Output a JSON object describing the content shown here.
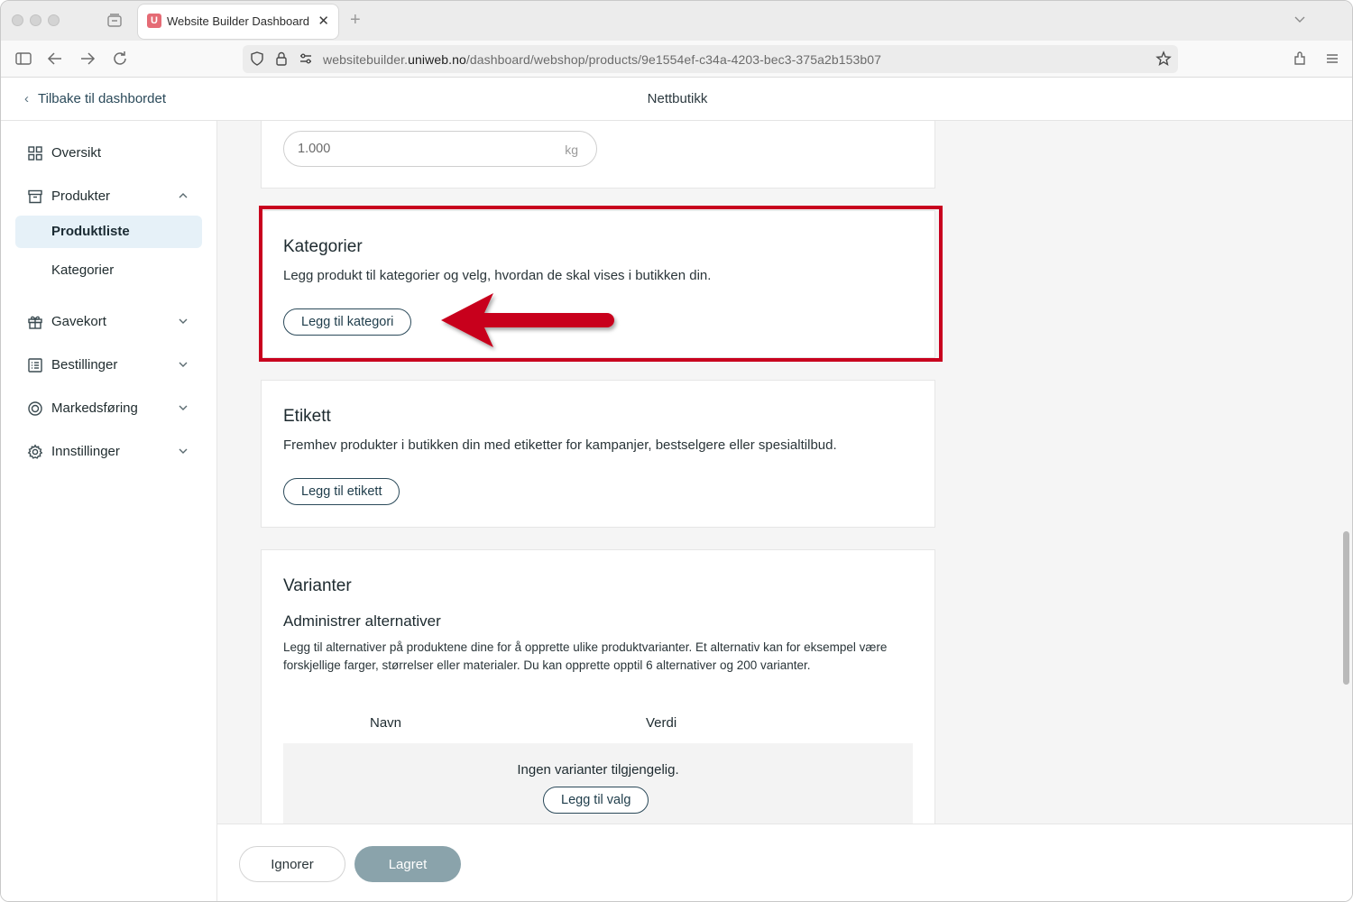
{
  "browser": {
    "tab_title": "Website Builder Dashboard",
    "favicon_letter": "U",
    "url_prefix": "websitebuilder.",
    "url_host": "uniweb.no",
    "url_path": "/dashboard/webshop/products/9e1554ef-c34a-4203-bec3-375a2b153b07"
  },
  "header": {
    "back_label": "Tilbake til dashbordet",
    "title": "Nettbutikk"
  },
  "sidebar": {
    "items": [
      {
        "label": "Oversikt",
        "icon": "grid-icon"
      },
      {
        "label": "Produkter",
        "icon": "archive-box-icon",
        "expanded": true
      },
      {
        "label": "Produktliste",
        "active": true
      },
      {
        "label": "Kategorier"
      },
      {
        "label": "Gavekort",
        "icon": "gift-icon"
      },
      {
        "label": "Bestillinger",
        "icon": "list-icon"
      },
      {
        "label": "Markedsføring",
        "icon": "target-icon"
      },
      {
        "label": "Innstillinger",
        "icon": "gear-icon"
      }
    ]
  },
  "weight": {
    "value": "1.000",
    "unit": "kg"
  },
  "categories": {
    "title": "Kategorier",
    "description": "Legg produkt til kategorier og velg, hvordan de skal vises i butikken din.",
    "button": "Legg til kategori"
  },
  "label_section": {
    "title": "Etikett",
    "description": "Fremhev produkter i butikken din med etiketter for kampanjer, bestselgere eller spesialtilbud.",
    "button": "Legg til etikett"
  },
  "variants": {
    "title": "Varianter",
    "subtitle": "Administrer alternativer",
    "description": "Legg til alternativer på produktene dine for å opprette ulike produktvarianter. Et alternativ kan for eksempel være forskjellige farger, størrelser eller materialer. Du kan opprette opptil 6 alternativer og 200 varianter.",
    "col_name": "Navn",
    "col_value": "Verdi",
    "empty_message": "Ingen varianter tilgjengelig.",
    "add_button": "Legg til valg"
  },
  "footer": {
    "ignore": "Ignorer",
    "saved": "Lagret"
  },
  "colors": {
    "highlight": "#c8001e",
    "accent": "#2b4a5a",
    "active_bg": "#e6f1f8"
  }
}
